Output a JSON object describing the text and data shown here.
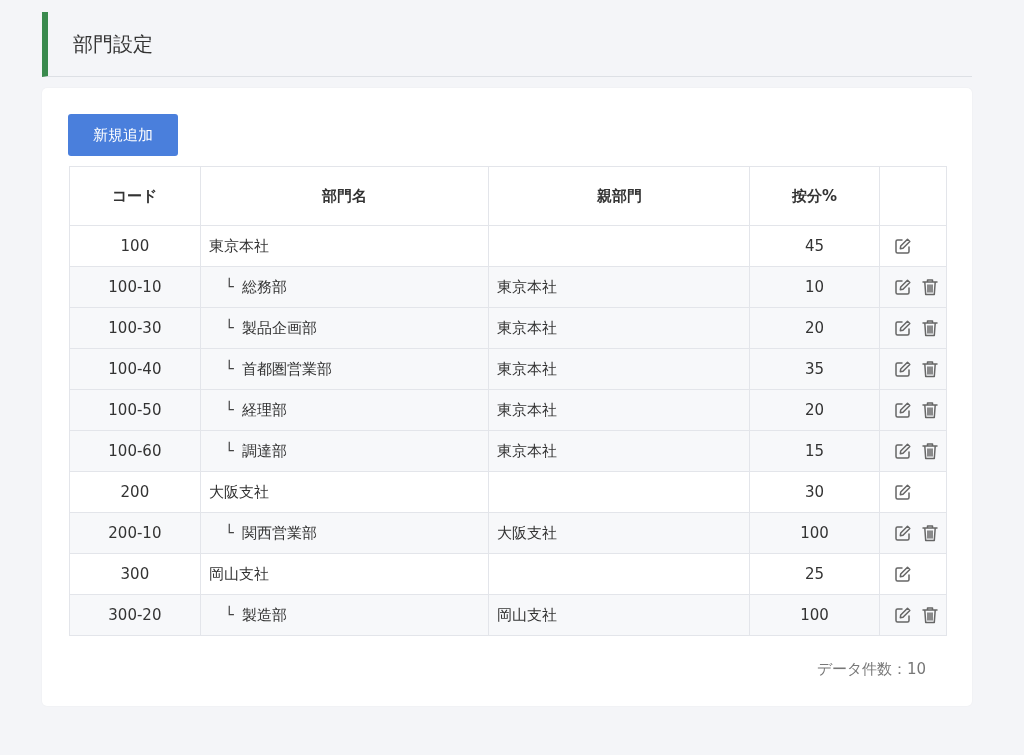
{
  "page": {
    "title": "部門設定"
  },
  "toolbar": {
    "add_button": "新規追加"
  },
  "table": {
    "columns": [
      "コード",
      "部門名",
      "親部門",
      "按分%"
    ],
    "rows": [
      {
        "code": "100",
        "name": "東京本社",
        "parent": "",
        "ratio": "45",
        "deletable": false,
        "children": [
          {
            "code": "100-10",
            "branch": "└",
            "name": "総務部",
            "parent": "東京本社",
            "ratio": "10",
            "deletable": true
          },
          {
            "code": "100-30",
            "branch": "└",
            "name": "製品企画部",
            "parent": "東京本社",
            "ratio": "20",
            "deletable": true
          },
          {
            "code": "100-40",
            "branch": "└",
            "name": "首都圏営業部",
            "parent": "東京本社",
            "ratio": "35",
            "deletable": true
          },
          {
            "code": "100-50",
            "branch": "└",
            "name": "経理部",
            "parent": "東京本社",
            "ratio": "20",
            "deletable": true
          },
          {
            "code": "100-60",
            "branch": "└",
            "name": "調達部",
            "parent": "東京本社",
            "ratio": "15",
            "deletable": true
          }
        ]
      },
      {
        "code": "200",
        "name": "大阪支社",
        "parent": "",
        "ratio": "30",
        "deletable": false,
        "children": [
          {
            "code": "200-10",
            "branch": "└",
            "name": "関西営業部",
            "parent": "大阪支社",
            "ratio": "100",
            "deletable": true
          }
        ]
      },
      {
        "code": "300",
        "name": "岡山支社",
        "parent": "",
        "ratio": "25",
        "deletable": false,
        "children": [
          {
            "code": "300-20",
            "branch": "└",
            "name": "製造部",
            "parent": "岡山支社",
            "ratio": "100",
            "deletable": true
          }
        ]
      }
    ]
  },
  "footer": {
    "count": "データ件数：10"
  }
}
